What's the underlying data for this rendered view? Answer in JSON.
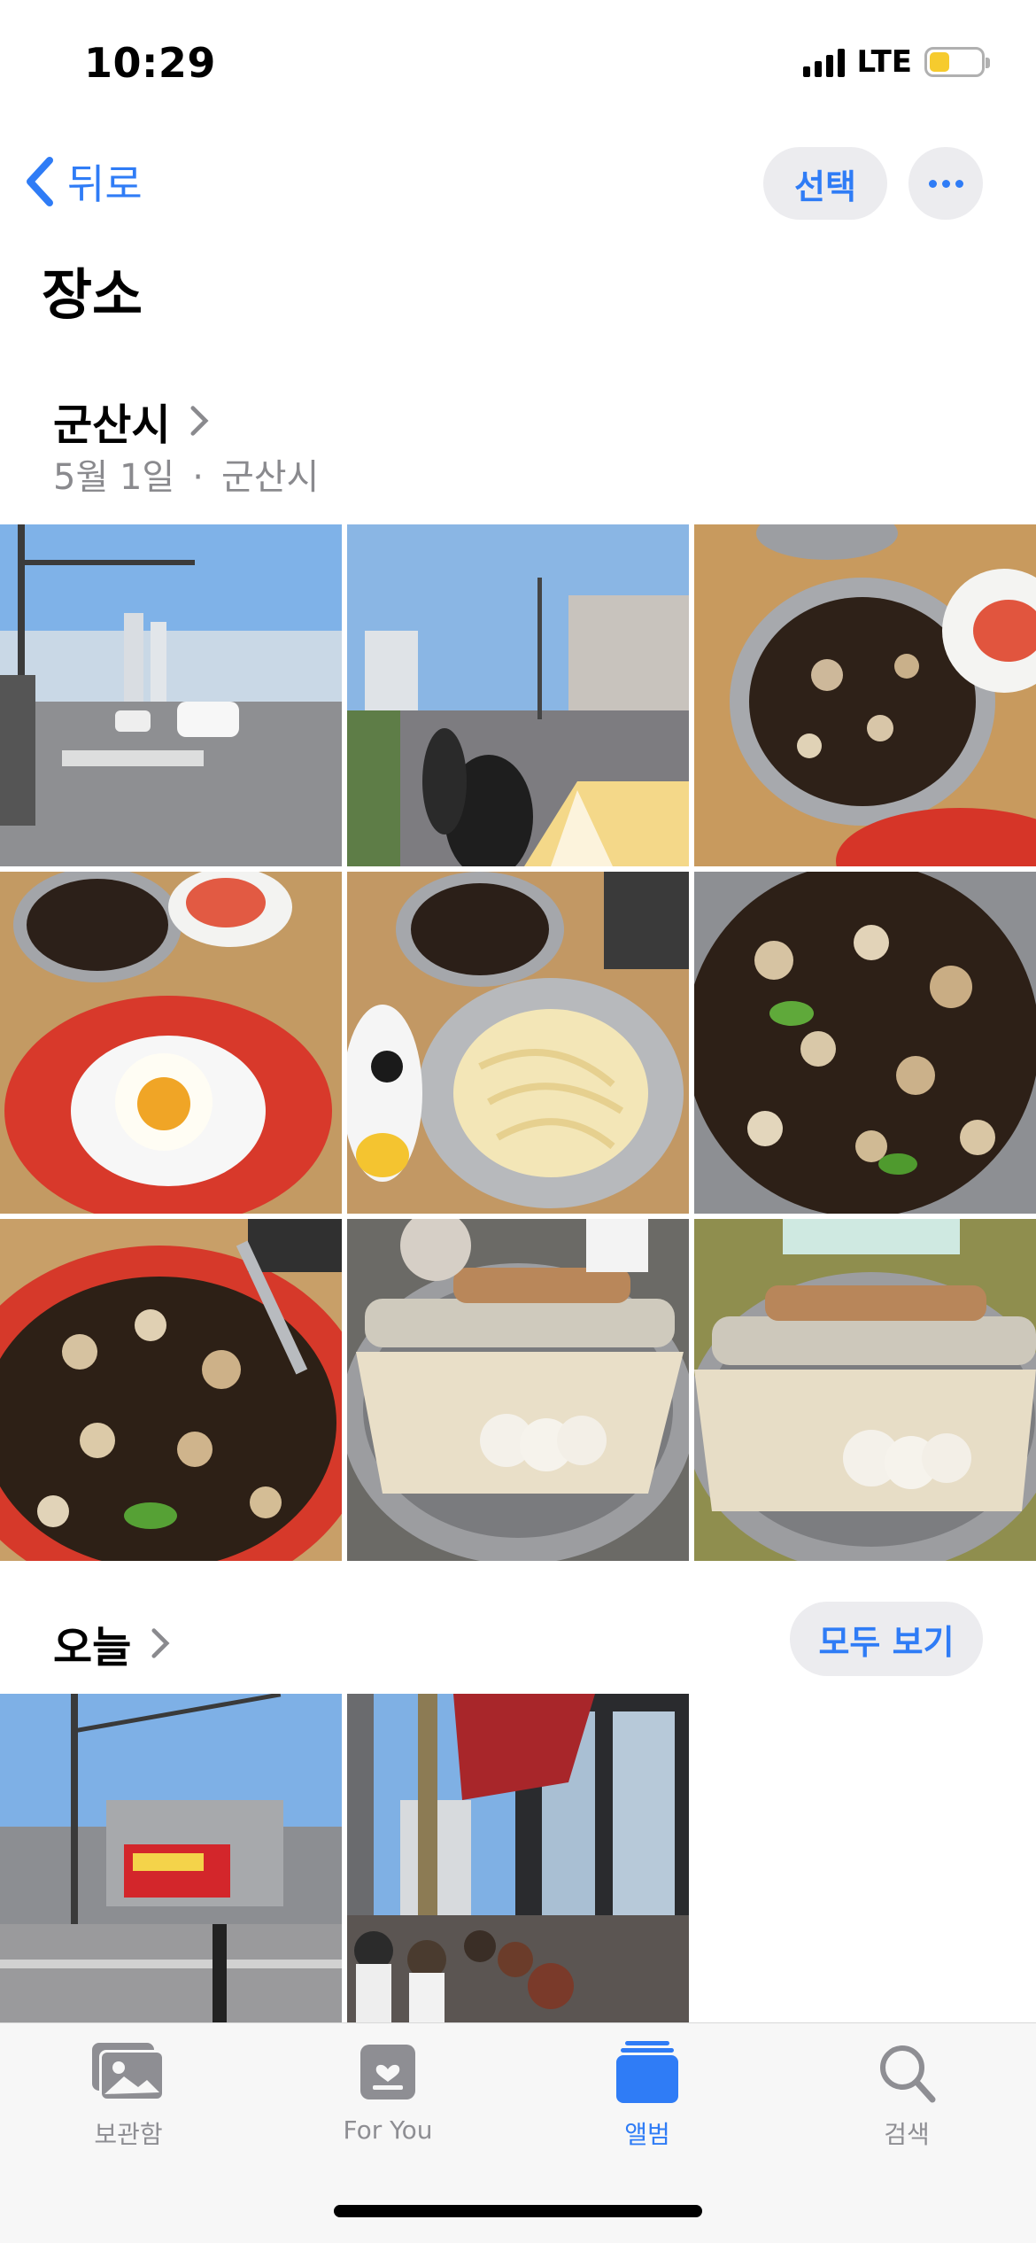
{
  "status_bar": {
    "time": "10:29",
    "network": "LTE",
    "battery_level": 0.4
  },
  "nav": {
    "back_label": "뒤로",
    "select_label": "선택"
  },
  "page_title": "장소",
  "sections": [
    {
      "title": "군산시",
      "date": "5월 1일",
      "separator": "·",
      "place": "군산시"
    },
    {
      "title": "오늘",
      "see_all_label": "모두 보기"
    }
  ],
  "tabs": [
    {
      "label": "보관함",
      "icon": "photo-library-icon",
      "active": false
    },
    {
      "label": "For You",
      "icon": "for-you-icon",
      "active": false
    },
    {
      "label": "앨범",
      "icon": "albums-icon",
      "active": true
    },
    {
      "label": "검색",
      "icon": "search-icon",
      "active": false
    }
  ],
  "colors": {
    "accent": "#2f7cf6",
    "pill_bg": "#ececef",
    "tabbar_bg": "#f7f7f7",
    "inactive": "#8e8e93"
  }
}
